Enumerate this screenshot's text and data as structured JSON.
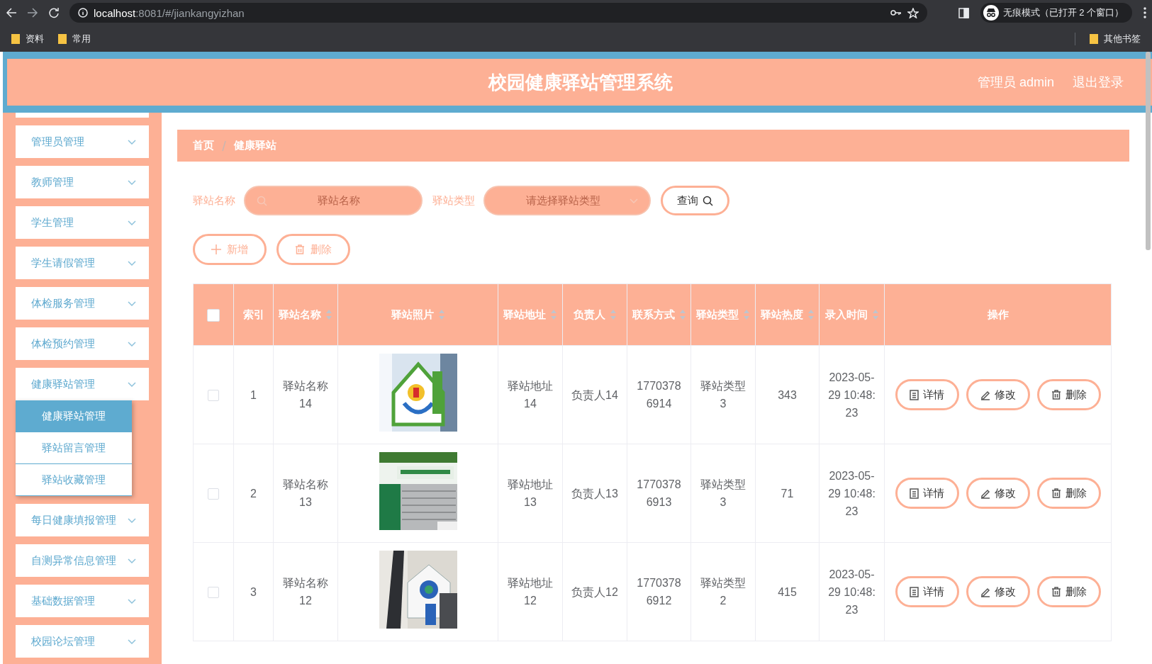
{
  "browser": {
    "url_host": "localhost",
    "url_rest": ":8081/#/jiankangyizhan",
    "incognito": "无痕模式（已打开 2 个窗口）",
    "bookmarks": [
      "资料",
      "常用"
    ],
    "other_bookmarks": "其他书签"
  },
  "header": {
    "title": "校园健康驿站管理系统",
    "user": "管理员 admin",
    "logout": "退出登录"
  },
  "sidebar": {
    "items": [
      {
        "label": "管理员管理"
      },
      {
        "label": "教师管理"
      },
      {
        "label": "学生管理"
      },
      {
        "label": "学生请假管理"
      },
      {
        "label": "体检服务管理"
      },
      {
        "label": "体检预约管理"
      },
      {
        "label": "健康驿站管理",
        "children": [
          {
            "label": "健康驿站管理",
            "selected": true
          },
          {
            "label": "驿站留言管理",
            "selected": false
          },
          {
            "label": "驿站收藏管理",
            "selected": false
          }
        ]
      },
      {
        "label": "每日健康填报管理"
      },
      {
        "label": "自测异常信息管理"
      },
      {
        "label": "基础数据管理"
      },
      {
        "label": "校园论坛管理"
      }
    ]
  },
  "breadcrumb": [
    "首页",
    "健康驿站"
  ],
  "search": {
    "fields": [
      {
        "label": "驿站名称",
        "kind": "input",
        "placeholder": "驿站名称"
      },
      {
        "label": "驿站类型",
        "kind": "select",
        "placeholder": "请选择驿站类型"
      }
    ],
    "button": "查询"
  },
  "actions": [
    {
      "label": "新增",
      "kind": "add"
    },
    {
      "label": "删除",
      "kind": "delete"
    }
  ],
  "table": {
    "all_checked": false,
    "columns": [
      {
        "label": "索引",
        "sortable": false
      },
      {
        "label": "驿站名称",
        "sortable": true
      },
      {
        "label": "驿站照片",
        "sortable": true
      },
      {
        "label": "驿站地址",
        "sortable": true
      },
      {
        "label": "负责人",
        "sortable": true
      },
      {
        "label": "联系方式",
        "sortable": true
      },
      {
        "label": "驿站类型",
        "sortable": true
      },
      {
        "label": "驿站热度",
        "sortable": true
      },
      {
        "label": "录入时间",
        "sortable": true
      },
      {
        "label": "操作",
        "sortable": false
      }
    ],
    "rows": [
      {
        "checked": false,
        "index": "1",
        "name": "驿站名称14",
        "address": "驿站地址14",
        "person": "负责人14",
        "contact": "17703786914",
        "type": "驿站类型3",
        "heat": "343",
        "time": "2023-05-29 10:48:23",
        "buttons": [
          {
            "label": "详情",
            "kind": "detail"
          },
          {
            "label": "修改",
            "kind": "edit"
          },
          {
            "label": "删除",
            "kind": "delete"
          }
        ]
      },
      {
        "checked": false,
        "index": "2",
        "name": "驿站名称13",
        "address": "驿站地址13",
        "person": "负责人13",
        "contact": "17703786913",
        "type": "驿站类型3",
        "heat": "71",
        "time": "2023-05-29 10:48:23",
        "buttons": [
          {
            "label": "详情",
            "kind": "detail"
          },
          {
            "label": "修改",
            "kind": "edit"
          },
          {
            "label": "删除",
            "kind": "delete"
          }
        ]
      },
      {
        "checked": false,
        "index": "3",
        "name": "驿站名称12",
        "address": "驿站地址12",
        "person": "负责人12",
        "contact": "17703786912",
        "type": "驿站类型2",
        "heat": "415",
        "time": "2023-05-29 10:48:23",
        "buttons": [
          {
            "label": "详情",
            "kind": "detail"
          },
          {
            "label": "修改",
            "kind": "edit"
          },
          {
            "label": "删除",
            "kind": "delete"
          }
        ]
      }
    ]
  }
}
